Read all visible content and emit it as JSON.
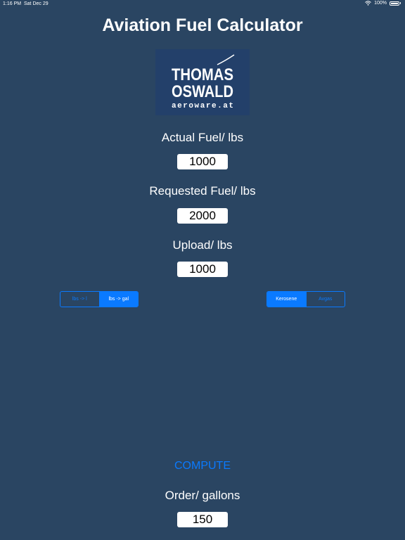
{
  "status_bar": {
    "time": "1:16 PM",
    "date": "Sat Dec 29",
    "battery": "100%"
  },
  "title": "Aviation Fuel Calculator",
  "logo": {
    "line1": "THOMAS",
    "line2": "OSWALD",
    "line3": "aeroware.at"
  },
  "actual_fuel": {
    "label": "Actual Fuel/ lbs",
    "value": "1000"
  },
  "requested_fuel": {
    "label": "Requested Fuel/ lbs",
    "value": "2000"
  },
  "upload": {
    "label": "Upload/ lbs",
    "value": "1000"
  },
  "unit_conversion": {
    "options": [
      "lbs -> l",
      "lbs -> gal"
    ],
    "selected": "lbs -> gal"
  },
  "fuel_type": {
    "options": [
      "Kerosene",
      "Avgas"
    ],
    "selected": "Kerosene"
  },
  "compute_label": "COMPUTE",
  "order": {
    "label": "Order/ gallons",
    "value": "150"
  },
  "colors": {
    "background": "#2a4562",
    "accent": "#0a7aff",
    "logo_bg": "#23406a"
  }
}
